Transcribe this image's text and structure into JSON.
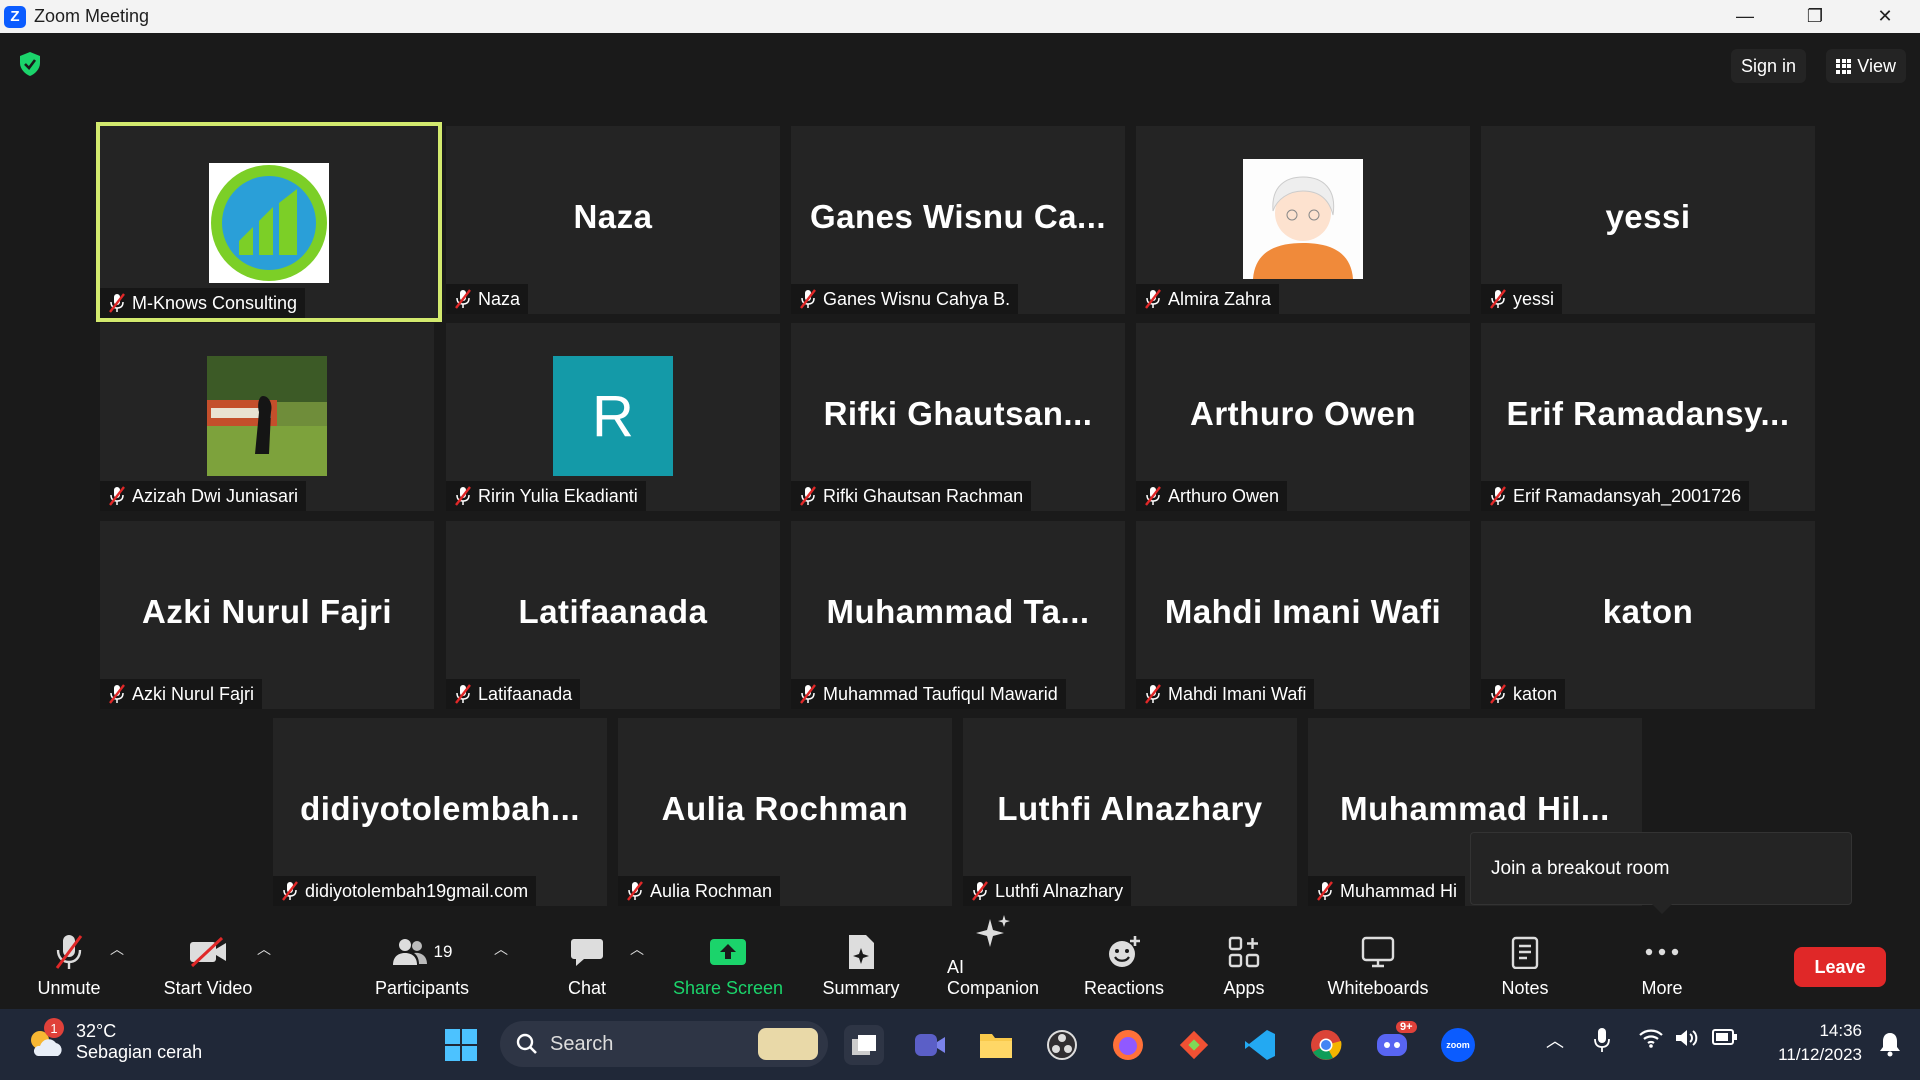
{
  "window": {
    "title": "Zoom Meeting"
  },
  "topbar": {
    "sign_in": "Sign in",
    "view": "View"
  },
  "participants": [
    {
      "big": "",
      "label": "M-Knows Consulting",
      "avatar": "logo",
      "active": true
    },
    {
      "big": "Naza",
      "label": "Naza"
    },
    {
      "big": "Ganes  Wisnu  Ca...",
      "label": "Ganes Wisnu Cahya B."
    },
    {
      "big": "",
      "label": "Almira Zahra",
      "avatar": "cartoon"
    },
    {
      "big": "yessi",
      "label": "yessi"
    },
    {
      "big": "",
      "label": "Azizah Dwi Juniasari",
      "avatar": "photo"
    },
    {
      "big": "",
      "label": "Ririn Yulia Ekadianti",
      "avatar": "letter",
      "letter": "R"
    },
    {
      "big": "Rifki  Ghautsan...",
      "label": "Rifki Ghautsan Rachman"
    },
    {
      "big": "Arthuro Owen",
      "label": "Arthuro Owen"
    },
    {
      "big": "Erif  Ramadansy...",
      "label": "Erif Ramadansyah_2001726"
    },
    {
      "big": "Azki Nurul Fajri",
      "label": "Azki Nurul Fajri"
    },
    {
      "big": "Latifaanada",
      "label": "Latifaanada"
    },
    {
      "big": "Muhammad  Ta...",
      "label": "Muhammad Taufiqul Mawarid"
    },
    {
      "big": "Mahdi Imani Wafi",
      "label": "Mahdi Imani Wafi"
    },
    {
      "big": "katon",
      "label": "katon"
    },
    {
      "big": "didiyotolembah...",
      "label": "didiyotolembah19gmail.com"
    },
    {
      "big": "Aulia Rochman",
      "label": "Aulia Rochman"
    },
    {
      "big": "Luthfi Alnazhary",
      "label": "Luthfi Alnazhary"
    },
    {
      "big": "Muhammad  Hil...",
      "label": "Muhammad Hi"
    }
  ],
  "popup": {
    "text": "Join a breakout room"
  },
  "toolbar": {
    "unmute": "Unmute",
    "start_video": "Start Video",
    "participants": "Participants",
    "participants_count": "19",
    "chat": "Chat",
    "share_screen": "Share Screen",
    "summary": "Summary",
    "ai_companion": "AI Companion",
    "reactions": "Reactions",
    "apps": "Apps",
    "whiteboards": "Whiteboards",
    "notes": "Notes",
    "more": "More",
    "leave": "Leave"
  },
  "taskbar": {
    "weather_badge": "1",
    "temperature": "32°C",
    "weather_desc": "Sebagian cerah",
    "search": "Search",
    "discord_badge": "9+",
    "zoom_app": "zoom",
    "time": "14:36",
    "date": "11/12/2023"
  },
  "colors": {
    "active_border": "#d3ea6e",
    "share_green": "#1bd46b",
    "leave_red": "#e02828",
    "tile_bg": "#242424"
  }
}
